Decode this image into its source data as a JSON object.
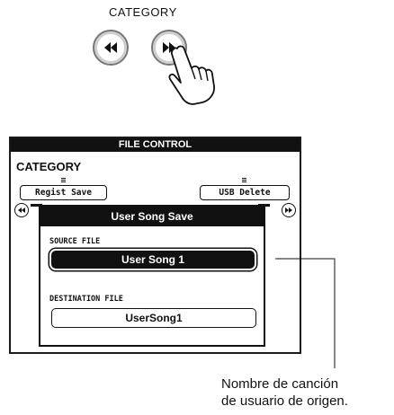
{
  "panel": {
    "category_label": "CATEGORY"
  },
  "lcd": {
    "title": "FILE CONTROL",
    "category_heading": "CATEGORY",
    "tabs": {
      "left": "Regist Save",
      "right": "USB Delete"
    },
    "dialog": {
      "title": "User Song Save",
      "source_label": "SOURCE FILE",
      "source_value": "User Song 1",
      "destination_label": "DESTINATION FILE",
      "destination_value": "UserSong1"
    }
  },
  "callout": {
    "line1": "Nombre de canción",
    "line2": "de usuario de origen."
  },
  "icons": {
    "prev": "rewind-icon",
    "next": "fast-forward-icon",
    "hand": "pointing-hand-icon"
  }
}
